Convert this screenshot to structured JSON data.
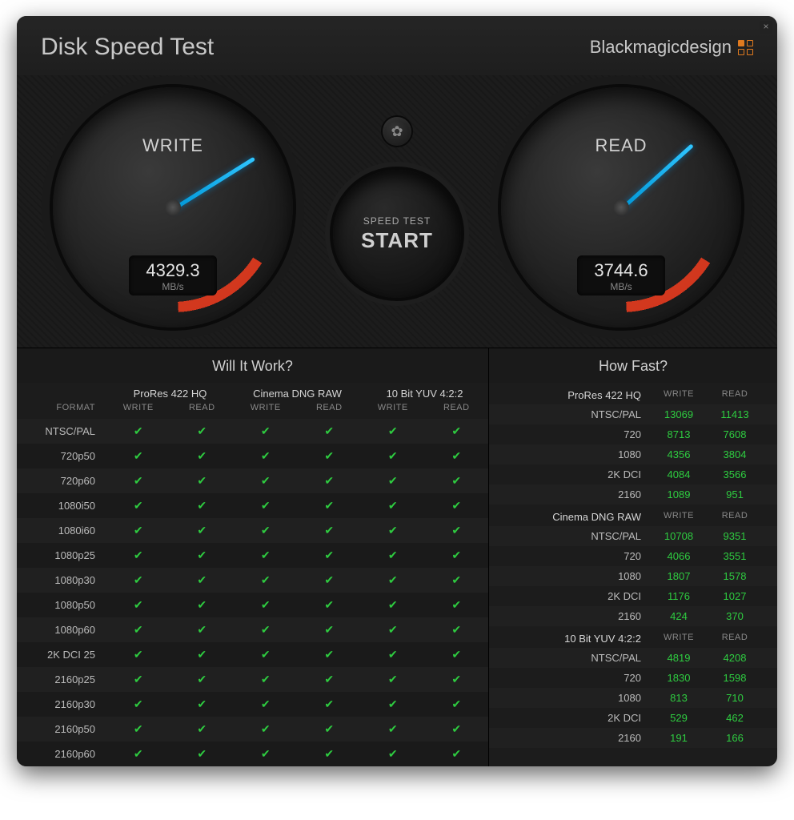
{
  "header": {
    "title": "Disk Speed Test",
    "brand": "Blackmagicdesign"
  },
  "gauges": {
    "write": {
      "label": "WRITE",
      "value": "4329.3",
      "unit": "MB/s",
      "needle_deg": -32
    },
    "read": {
      "label": "READ",
      "value": "3744.6",
      "unit": "MB/s",
      "needle_deg": -42
    }
  },
  "start": {
    "small": "SPEED TEST",
    "big": "START"
  },
  "panels": {
    "wiw": "Will It Work?",
    "hf": "How Fast?"
  },
  "wiw": {
    "codecs": [
      "ProRes 422 HQ",
      "Cinema DNG RAW",
      "10 Bit YUV 4:2:2"
    ],
    "sub": [
      "WRITE",
      "READ",
      "WRITE",
      "READ",
      "WRITE",
      "READ"
    ],
    "format_header": "FORMAT",
    "formats": [
      "NTSC/PAL",
      "720p50",
      "720p60",
      "1080i50",
      "1080i60",
      "1080p25",
      "1080p30",
      "1080p50",
      "1080p60",
      "2K DCI 25",
      "2160p25",
      "2160p30",
      "2160p50",
      "2160p60"
    ]
  },
  "hf": {
    "groups": [
      {
        "name": "ProRes 422 HQ",
        "rows": [
          {
            "res": "NTSC/PAL",
            "w": "13069",
            "r": "11413"
          },
          {
            "res": "720",
            "w": "8713",
            "r": "7608"
          },
          {
            "res": "1080",
            "w": "4356",
            "r": "3804"
          },
          {
            "res": "2K DCI",
            "w": "4084",
            "r": "3566"
          },
          {
            "res": "2160",
            "w": "1089",
            "r": "951"
          }
        ]
      },
      {
        "name": "Cinema DNG RAW",
        "rows": [
          {
            "res": "NTSC/PAL",
            "w": "10708",
            "r": "9351"
          },
          {
            "res": "720",
            "w": "4066",
            "r": "3551"
          },
          {
            "res": "1080",
            "w": "1807",
            "r": "1578"
          },
          {
            "res": "2K DCI",
            "w": "1176",
            "r": "1027"
          },
          {
            "res": "2160",
            "w": "424",
            "r": "370"
          }
        ]
      },
      {
        "name": "10 Bit YUV 4:2:2",
        "rows": [
          {
            "res": "NTSC/PAL",
            "w": "4819",
            "r": "4208"
          },
          {
            "res": "720",
            "w": "1830",
            "r": "1598"
          },
          {
            "res": "1080",
            "w": "813",
            "r": "710"
          },
          {
            "res": "2K DCI",
            "w": "529",
            "r": "462"
          },
          {
            "res": "2160",
            "w": "191",
            "r": "166"
          }
        ]
      }
    ],
    "sub": {
      "w": "WRITE",
      "r": "READ"
    }
  }
}
